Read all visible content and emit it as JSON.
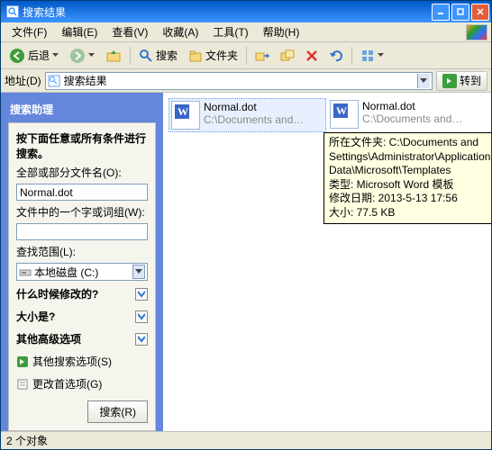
{
  "window": {
    "title": "搜索结果"
  },
  "menu": {
    "file": "文件(F)",
    "edit": "编辑(E)",
    "view": "查看(V)",
    "favorites": "收藏(A)",
    "tools": "工具(T)",
    "help": "帮助(H)"
  },
  "toolbar": {
    "back": "后退",
    "search": "搜索",
    "folders": "文件夹"
  },
  "addressbar": {
    "label": "地址(D)",
    "value": "搜索结果",
    "go": "转到"
  },
  "sidebar": {
    "header": "搜索助理",
    "prompt": "按下面任意或所有条件进行搜索。",
    "filename_label": "全部或部分文件名(O):",
    "filename_value": "Normal.dot",
    "content_label": "文件中的一个字或词组(W):",
    "content_value": "",
    "lookin_label": "查找范围(L):",
    "lookin_value": "本地磁盘 (C:)",
    "when_modified": "什么时候修改的?",
    "what_size": "大小是?",
    "more_options": "其他高级选项",
    "other_search": "其他搜索选项(S)",
    "change_prefs": "更改首选项(G)",
    "search_btn": "搜索(R)"
  },
  "results": [
    {
      "name": "Normal.dot",
      "path": "C:\\Documents and…",
      "selected": true
    },
    {
      "name": "Normal.dot",
      "path": "C:\\Documents and…",
      "selected": false
    }
  ],
  "tooltip": {
    "folder_label": "所在文件夹: ",
    "folder": "C:\\Documents and Settings\\Administrator\\Application Data\\Microsoft\\Templates",
    "type_label": "类型: ",
    "type": "Microsoft Word 模板",
    "date_label": "修改日期: ",
    "date": "2013-5-13 17:56",
    "size_label": "大小: ",
    "size": "77.5 KB"
  },
  "status": {
    "text": "2 个对象"
  }
}
